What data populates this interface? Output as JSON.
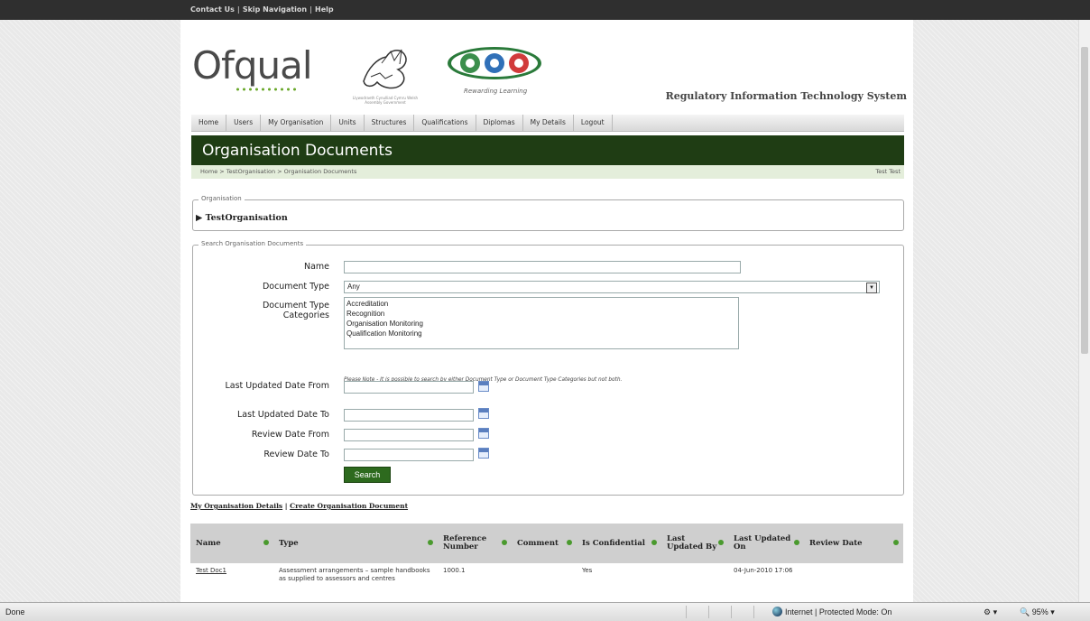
{
  "top_links": [
    "Contact Us",
    "Skip Navigation",
    "Help"
  ],
  "top_link_sep": "|",
  "header": {
    "logo_text": "Ofqual",
    "welsh_caption": "Llywodraeth Cynulliad Cymru Welsh Assembly Government",
    "cea_caption": "Rewarding Learning",
    "system_title": "Regulatory Information Technology System"
  },
  "nav": [
    "Home",
    "Users",
    "My Organisation",
    "Units",
    "Structures",
    "Qualifications",
    "Diplomas",
    "My Details",
    "Logout"
  ],
  "page_title": "Organisation Documents",
  "breadcrumb": "Home > TestOrganisation > Organisation Documents",
  "user_name": "Test Test",
  "organisation": {
    "legend": "Organisation",
    "name": "TestOrganisation",
    "expand_glyph": "▶"
  },
  "search": {
    "legend": "Search Organisation Documents",
    "name_label": "Name",
    "name_value": "",
    "doc_type_label": "Document Type",
    "doc_type_value": "Any",
    "categories_label": "Document Type Categories",
    "categories": [
      "Accreditation",
      "Recognition",
      "Organisation Monitoring",
      "Qualification Monitoring"
    ],
    "note": "Please Note - It is possible to search by either Document Type or Document Type Categories but not both.",
    "updated_from_label": "Last Updated Date From",
    "updated_to_label": "Last Updated Date To",
    "review_from_label": "Review Date From",
    "review_to_label": "Review Date To",
    "search_button": "Search"
  },
  "links": {
    "details": "My Organisation Details",
    "sep": "|",
    "create": "Create Organisation Document"
  },
  "table": {
    "headers": [
      "Name",
      "Type",
      "Reference Number",
      "Comment",
      "Is Confidential",
      "Last Updated By",
      "Last Updated On",
      "Review Date"
    ],
    "rows": [
      [
        "Test Doc1",
        "Assessment arrangements – sample handbooks as supplied to assessors and centres",
        "1000.1",
        "",
        "Yes",
        "",
        "04-Jun-2010 17:06",
        ""
      ]
    ]
  },
  "status": {
    "left": "Done",
    "zone": "Internet | Protected Mode: On",
    "zoom": "🔍 95%",
    "zoom_arrow": "▾"
  },
  "colors": {
    "title_bar": "#1f3d14",
    "crumb_bar": "#e4eedb",
    "button": "#2d6a1e",
    "sort_dot": "#4a9a2e"
  }
}
